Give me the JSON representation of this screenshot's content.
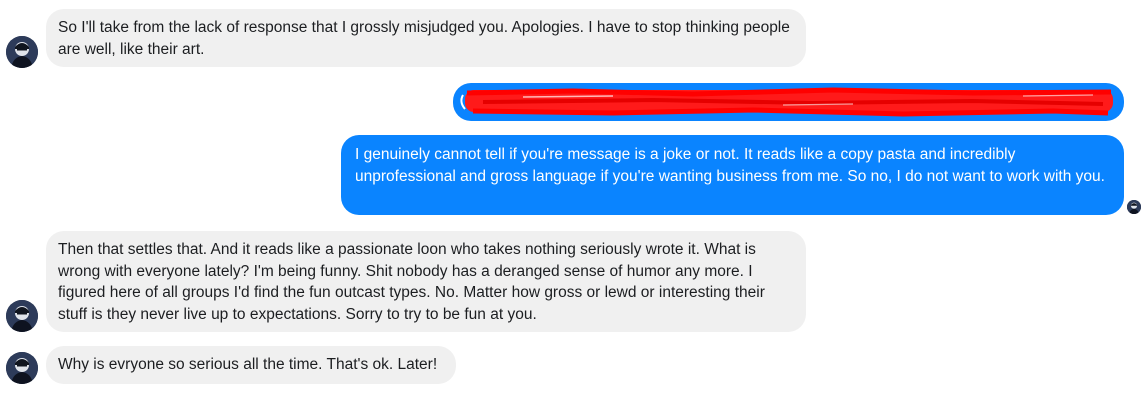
{
  "conversation": {
    "messages": [
      {
        "sender": "other",
        "text": "So I'll take from the lack of response that I grossly misjudged you. Apologies.  I have to stop thinking people are well, like their art."
      },
      {
        "sender": "self",
        "text": "",
        "redacted": true
      },
      {
        "sender": "self",
        "text": "I genuinely cannot tell if you're message is a joke or not. It reads like a copy pasta and incredibly unprofessional and gross  language if you're wanting business from me. So no, I do not want to work with you."
      },
      {
        "sender": "other",
        "text": "Then that settles that. And it reads like a passionate loon who takes nothing seriously wrote it. What is wrong with everyone lately? I'm being funny.  Shit nobody has a deranged sense of humor any more. I figured here of all groups I'd find the fun outcast types. No. Matter how gross or lewd or interesting their stuff is they never live up to expectations.  Sorry to try to be fun at you."
      },
      {
        "sender": "other",
        "text": "Why is evryone so serious all the time. That's ok. Later!"
      }
    ]
  },
  "colors": {
    "incoming_bubble": "#f0f0f0",
    "outgoing_bubble": "#0a84ff",
    "redaction": "#ff0000",
    "avatar": "#26324a"
  },
  "icons": {
    "avatar": "avatar-icon",
    "seen": "seen-avatar-icon"
  }
}
